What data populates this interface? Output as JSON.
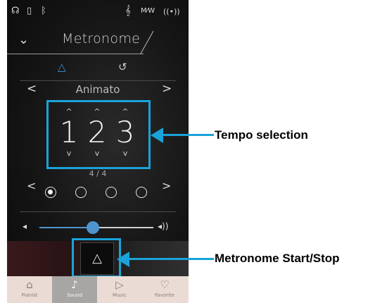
{
  "header": {
    "title": "Metronome"
  },
  "preset": {
    "name": "Animato"
  },
  "tempo": {
    "digits": [
      "1",
      "2",
      "3"
    ]
  },
  "beat": {
    "signature": "4 / 4",
    "selected_index": 0,
    "count": 4
  },
  "volume": {
    "level": 0.42
  },
  "bottom_nav": {
    "items": [
      {
        "label": "Pianist",
        "icon": "piano-icon"
      },
      {
        "label": "Sound",
        "icon": "music-note-icon"
      },
      {
        "label": "Music",
        "icon": "play-icon"
      },
      {
        "label": "Favorite",
        "icon": "heart-icon"
      }
    ],
    "active_index": 1
  },
  "annotations": {
    "tempo_selection": "Tempo selection",
    "metronome_start_stop": "Metronome Start/Stop"
  },
  "colors": {
    "highlight": "#1aa3d9",
    "accent": "#4e95d0",
    "nav_bg": "#eadcd5"
  }
}
